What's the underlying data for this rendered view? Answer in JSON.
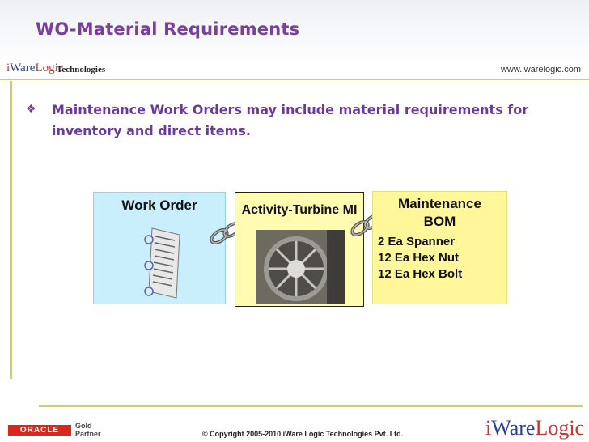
{
  "slide": {
    "title": "WO-Material Requirements",
    "brand_left": "iWareLogic",
    "brand_left_tech": "Technologies",
    "url": "www.iwarelogic.com",
    "bullet": "Maintenance Work Orders may include material requirements for inventory and direct items.",
    "work_order_label": "Work Order",
    "activity_label": "Activity-Turbine MI",
    "bom_title": "Maintenance BOM",
    "bom_items": [
      "2 Ea Spanner",
      "12 Ea Hex Nut",
      "12 Ea Hex Bolt"
    ],
    "footer_copyright": "© Copyright 2005-2010 iWare Logic Technologies Pvt. Ltd.",
    "oracle_logo": "ORACLE",
    "partner_text": "Gold Partner",
    "brand_right": "iWareLogic"
  },
  "colors": {
    "title": "#7a3f9a",
    "work_order_box": "#c9eefc",
    "activity_box": "#fffbb0",
    "bom_box": "#fff79a",
    "accent_line": "#c8cc8a"
  },
  "icons": [
    "diamond-bullet-icon",
    "document-icon",
    "chain-link-icon",
    "turbine-engine-image"
  ]
}
